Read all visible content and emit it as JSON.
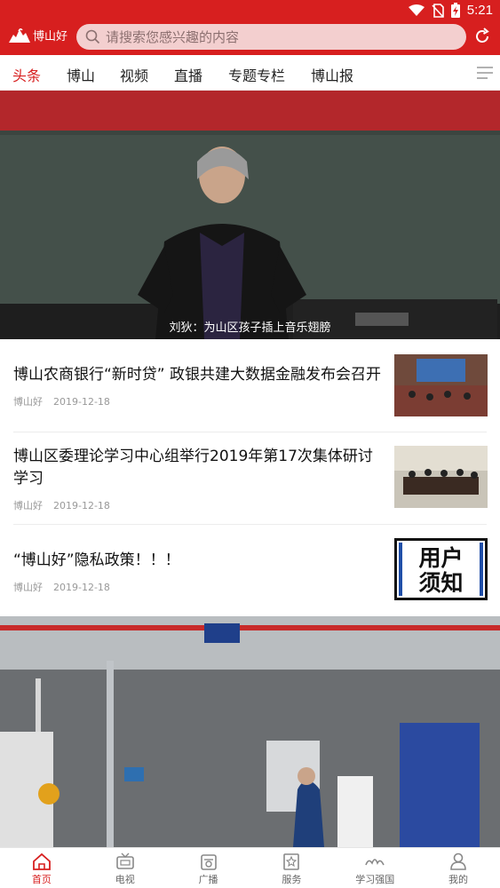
{
  "status_bar": {
    "time": "5:21"
  },
  "header": {
    "logo_text": "博山好",
    "search_placeholder": "请搜索您感兴趣的内容"
  },
  "tabs": [
    {
      "label": "头条",
      "active": true
    },
    {
      "label": "博山"
    },
    {
      "label": "视频"
    },
    {
      "label": "直播"
    },
    {
      "label": "专题专栏"
    },
    {
      "label": "博山报"
    }
  ],
  "hero": {
    "caption": "刘狄：为山区孩子插上音乐翅膀"
  },
  "news": [
    {
      "title": "博山农商银行“新时贷” 政银共建大数据金融发布会召开",
      "source": "博山好",
      "date": "2019-12-18"
    },
    {
      "title": "博山区委理论学习中心组举行2019年第17次集体研讨学习",
      "source": "博山好",
      "date": "2019-12-18"
    },
    {
      "title": "“博山好”隐私政策！！！",
      "source": "博山好",
      "date": "2019-12-18",
      "thumb_text": [
        "用户",
        "须知"
      ]
    }
  ],
  "bottom_nav": [
    {
      "label": "首页",
      "icon": "home-icon",
      "active": true
    },
    {
      "label": "电视",
      "icon": "tv-icon"
    },
    {
      "label": "广播",
      "icon": "radio-icon"
    },
    {
      "label": "服务",
      "icon": "service-icon"
    },
    {
      "label": "学习强国",
      "icon": "xuexi-icon"
    },
    {
      "label": "我的",
      "icon": "user-icon"
    }
  ],
  "colors": {
    "brand_red": "#d71f1f",
    "search_bg": "#f3cfcf",
    "inactive_gray": "#666666"
  }
}
